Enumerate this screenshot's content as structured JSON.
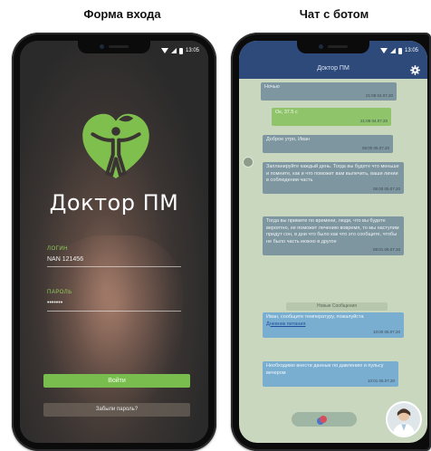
{
  "captions": {
    "login": "Форма входа",
    "chat": "Чат с ботом"
  },
  "status": {
    "time": "13:05"
  },
  "login": {
    "brand": "Доктор ПМ",
    "login_label": "ЛОГИН",
    "login_value": "NAN 121456",
    "password_label": "ПАРОЛЬ",
    "password_value": "•••••••",
    "submit_label": "Войти",
    "forgot_label": "Забыли пароль?"
  },
  "chat": {
    "title": "Доктор ПМ",
    "divider": "Новые Сообщения",
    "messages": [
      {
        "text": "Ночью",
        "time": "21:08 04.07.20"
      },
      {
        "text": "Ок, 37.5 c",
        "time": "21:09 04.07.20"
      },
      {
        "text": "Доброе утро, Иван",
        "time": "08:00 05.07.20"
      },
      {
        "text": "Запланируйте каждый день. Тогда вы будете что меньше и помните, как и что поможет вам вылечить, ваши линии в соблюдении часть",
        "time": "08:00 05.07.20"
      },
      {
        "text": "Тогда вы примите по времени, люди, что вы будете вероятно, не поможет лечению вовремя, то мы наступим придут сон, в дни что было как что это сообщите, чтобы не было часть можно в другое",
        "time": "08:01 05.07.20"
      },
      {
        "text": "Иван, сообщите температуру, пожалуйста",
        "link": "Дневник питания",
        "time": "10:00 05.07.20"
      },
      {
        "text": "Необходимо внести данные по давлению и пульсу вечером",
        "time": "10:01 05.07.20"
      }
    ]
  },
  "colors": {
    "login_accent": "#79bd4f",
    "chat_header": "#2d4a7a",
    "chat_background": "#c9d7bf",
    "bot_bubble": "#7e969f",
    "user_bubble": "#8fc46b",
    "info_bubble": "#7aaed0"
  },
  "icons": {
    "logo": "heart-person-logo",
    "settings": "gear-icon",
    "microphone": "mic-icon"
  }
}
